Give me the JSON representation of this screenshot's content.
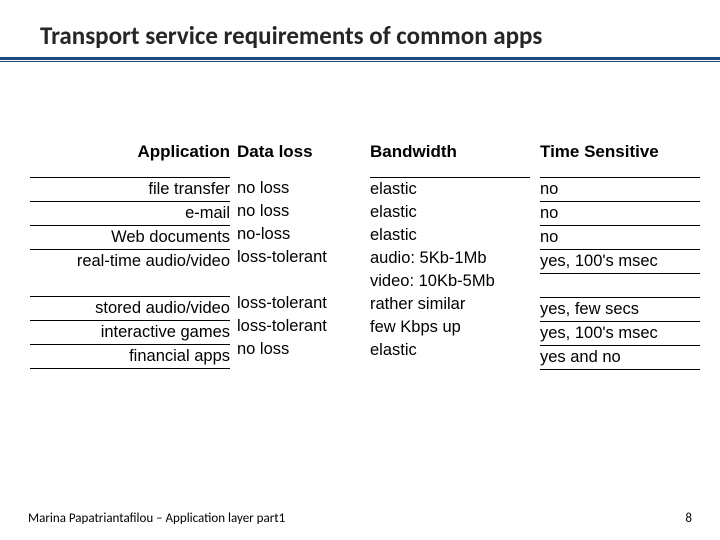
{
  "title": "Transport service requirements of common apps",
  "headers": {
    "application": "Application",
    "data_loss": "Data loss",
    "bandwidth": "Bandwidth",
    "time_sensitive": "Time Sensitive"
  },
  "rows": [
    {
      "app": "file transfer",
      "loss": "no loss",
      "bw": "elastic",
      "ts": "no"
    },
    {
      "app": "e-mail",
      "loss": "no loss",
      "bw": "elastic",
      "ts": "no"
    },
    {
      "app": "Web documents",
      "loss": "no-loss",
      "bw": "elastic",
      "ts": "no"
    },
    {
      "app": "real-time audio/video",
      "loss": "loss-tolerant",
      "bw": "audio: 5Kb-1Mb",
      "ts": "yes, 100's msec"
    },
    {
      "app": "",
      "loss": "",
      "bw": "video: 10Kb-5Mb",
      "ts": ""
    },
    {
      "app": "stored audio/video",
      "loss": "loss-tolerant",
      "bw": "rather similar",
      "ts": "yes, few secs"
    },
    {
      "app": "interactive games",
      "loss": "loss-tolerant",
      "bw": "few Kbps up",
      "ts": "yes, 100's msec"
    },
    {
      "app": "financial apps",
      "loss": "no loss",
      "bw": "elastic",
      "ts": "yes and no"
    }
  ],
  "footer": {
    "author_line": "Marina Papatriantafilou –  Application layer part1",
    "page": "8"
  },
  "chart_data": {
    "type": "table",
    "title": "Transport service requirements of common apps",
    "columns": [
      "Application",
      "Data loss",
      "Bandwidth",
      "Time Sensitive"
    ],
    "rows": [
      [
        "file transfer",
        "no loss",
        "elastic",
        "no"
      ],
      [
        "e-mail",
        "no loss",
        "elastic",
        "no"
      ],
      [
        "Web documents",
        "no-loss",
        "elastic",
        "no"
      ],
      [
        "real-time audio/video",
        "loss-tolerant",
        "audio: 5Kb-1Mb; video: 10Kb-5Mb",
        "yes, 100's msec"
      ],
      [
        "stored audio/video",
        "loss-tolerant",
        "rather similar",
        "yes, few secs"
      ],
      [
        "interactive games",
        "loss-tolerant",
        "few Kbps up",
        "yes, 100's msec"
      ],
      [
        "financial apps",
        "no loss",
        "elastic",
        "yes and no"
      ]
    ]
  }
}
